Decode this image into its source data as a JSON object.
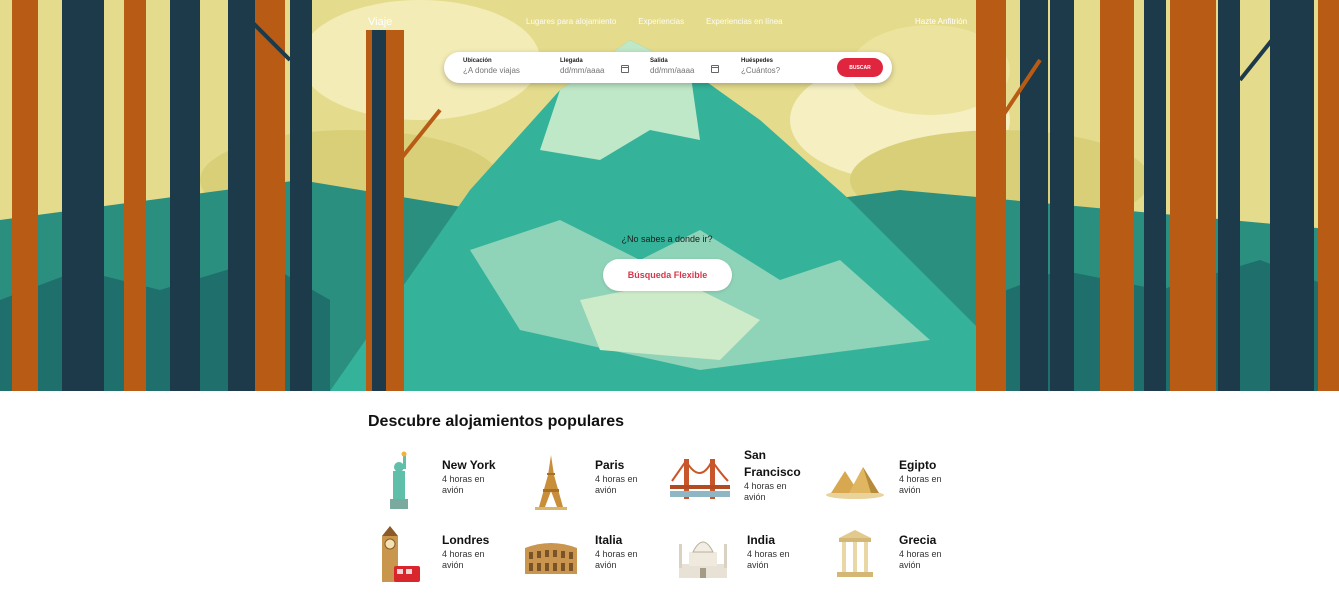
{
  "header": {
    "brand": "Viaje",
    "nav": [
      "Lugares para alojamiento",
      "Experiencias",
      "Experiencias en línea"
    ],
    "host_link": "Hazte Anfitrión"
  },
  "search": {
    "location": {
      "label": "Ubicación",
      "placeholder": "¿A donde viajas"
    },
    "arrival": {
      "label": "Llegada",
      "placeholder": "dd/mm/aaaa"
    },
    "departure": {
      "label": "Salida",
      "placeholder": "dd/mm/aaaa"
    },
    "guests": {
      "label": "Huéspedes",
      "placeholder": "¿Cuántos?"
    },
    "button": "BUSCAR"
  },
  "hero": {
    "question": "¿No sabes a donde ir?",
    "flexible_button": "Búsqueda Flexible"
  },
  "popular": {
    "title": "Descubre alojamientos populares",
    "items": [
      {
        "name": "New York",
        "time": "4 horas en avión",
        "icon": "statue-of-liberty-icon"
      },
      {
        "name": "Paris",
        "time": "4 horas en avión",
        "icon": "eiffel-tower-icon"
      },
      {
        "name": "San Francisco",
        "time": "4 horas en avión",
        "icon": "golden-gate-bridge-icon"
      },
      {
        "name": "Egipto",
        "time": "4 horas en avión",
        "icon": "pyramids-icon"
      },
      {
        "name": "Londres",
        "time": "4 horas en avión",
        "icon": "big-ben-icon"
      },
      {
        "name": "Italia",
        "time": "4 horas en avión",
        "icon": "colosseum-icon"
      },
      {
        "name": "India",
        "time": "4 horas en avión",
        "icon": "taj-mahal-icon"
      },
      {
        "name": "Grecia",
        "time": "4 horas en avión",
        "icon": "greek-temple-icon"
      }
    ]
  },
  "colors": {
    "accent": "#e0263f",
    "flexible_text": "#d4384a",
    "mountain": "#2fae95",
    "sky": "#e6df9a",
    "tree_dark": "#1c3a4a",
    "tree_orange": "#b85c15"
  }
}
